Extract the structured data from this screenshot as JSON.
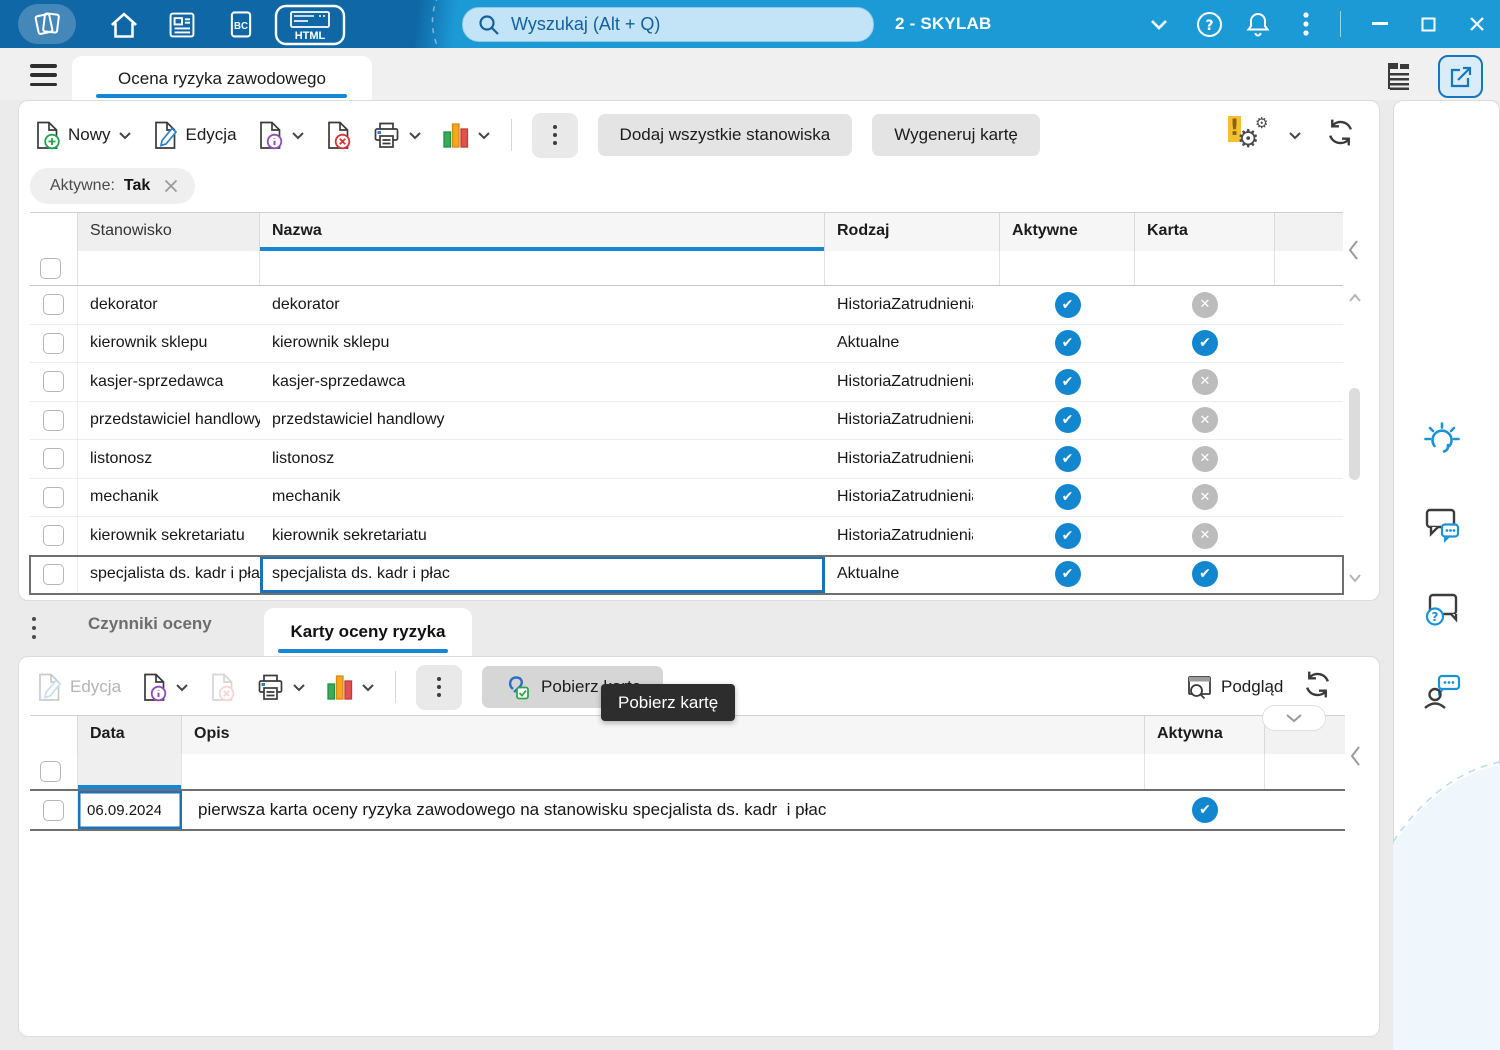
{
  "titlebar": {
    "search_placeholder": "Wyszukaj (Alt + Q)",
    "company_selector": "2 - SKYLAB",
    "bc_icon_label": "BC",
    "html_icon_label": "HTML"
  },
  "header": {
    "main_tab": "Ocena ryzyka zawodowego"
  },
  "top_toolbar": {
    "new_label": "Nowy",
    "edit_label": "Edycja",
    "add_all_button": "Dodaj wszystkie stanowiska",
    "generate_card_button": "Wygeneruj kartę"
  },
  "filter_chip": {
    "label": "Aktywne:",
    "value": "Tak"
  },
  "positions_table": {
    "headers": {
      "stanowisko": "Stanowisko",
      "nazwa": "Nazwa",
      "rodzaj": "Rodzaj",
      "aktywne": "Aktywne",
      "karta": "Karta"
    },
    "rows": [
      {
        "stanowisko": "dekorator",
        "nazwa": "dekorator",
        "rodzaj": "HistoriaZatrudnienia",
        "aktywne": true,
        "karta": false
      },
      {
        "stanowisko": "kierownik sklepu",
        "nazwa": "kierownik sklepu",
        "rodzaj": "Aktualne",
        "aktywne": true,
        "karta": true
      },
      {
        "stanowisko": "kasjer-sprzedawca",
        "nazwa": "kasjer-sprzedawca",
        "rodzaj": "HistoriaZatrudnienia",
        "aktywne": true,
        "karta": false
      },
      {
        "stanowisko": "przedstawiciel handlowy",
        "nazwa": "przedstawiciel handlowy",
        "rodzaj": "HistoriaZatrudnienia",
        "aktywne": true,
        "karta": false
      },
      {
        "stanowisko": "listonosz",
        "nazwa": "listonosz",
        "rodzaj": "HistoriaZatrudnienia",
        "aktywne": true,
        "karta": false
      },
      {
        "stanowisko": "mechanik",
        "nazwa": "mechanik",
        "rodzaj": "HistoriaZatrudnienia",
        "aktywne": true,
        "karta": false
      },
      {
        "stanowisko": "kierownik sekretariatu",
        "nazwa": "kierownik sekretariatu",
        "rodzaj": "HistoriaZatrudnienia",
        "aktywne": true,
        "karta": false
      },
      {
        "stanowisko": "specjalista ds. kadr i płac",
        "nazwa": "specjalista ds. kadr i płac",
        "rodzaj": "Aktualne",
        "aktywne": true,
        "karta": true
      }
    ]
  },
  "bottom_tabs": {
    "factors_tab": "Czynniki oceny",
    "cards_tab": "Karty oceny ryzyka"
  },
  "bottom_toolbar": {
    "edit_label": "Edycja",
    "download_card_button": "Pobierz kartę",
    "tooltip": "Pobierz kartę",
    "preview_label": "Podgląd"
  },
  "cards_table": {
    "headers": {
      "data": "Data",
      "opis": "Opis",
      "aktywna": "Aktywna"
    },
    "rows": [
      {
        "data": "06.09.2024",
        "opis": "pierwsza karta oceny ryzyka zawodowego na stanowisku specjalista ds. kadr  i płac",
        "aktywna": true
      }
    ]
  },
  "colors": {
    "titlebar_left": "#0f67a5",
    "titlebar_right": "#1b9ad6",
    "accent_blue": "#1787d3",
    "check_blue": "#1386d0",
    "inactive_gray": "#bcbcbc",
    "selection_border": "#1a72b8",
    "selected_row_border": "#6f6f6f"
  }
}
